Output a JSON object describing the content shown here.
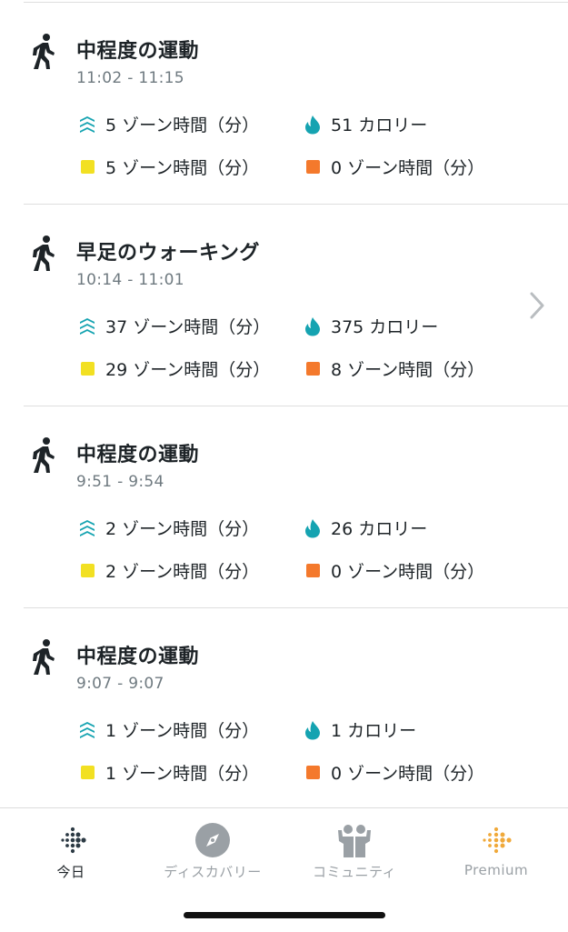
{
  "colors": {
    "accent_teal": "#15a3b1",
    "yellow": "#f2e022",
    "orange": "#f4792c",
    "premium": "#f0a93a"
  },
  "activities": [
    {
      "title": "中程度の運動",
      "time": "11:02 - 11:15",
      "active_zone": "5 ゾーン時間（分）",
      "calories": "51 カロリー",
      "fat_burn": "5 ゾーン時間（分）",
      "cardio": "0 ゾーン時間（分）",
      "has_chevron": false
    },
    {
      "title": "早足のウォーキング",
      "time": "10:14 - 11:01",
      "active_zone": "37 ゾーン時間（分）",
      "calories": "375 カロリー",
      "fat_burn": "29 ゾーン時間（分）",
      "cardio": "8 ゾーン時間（分）",
      "has_chevron": true
    },
    {
      "title": "中程度の運動",
      "time": "9:51 - 9:54",
      "active_zone": "2 ゾーン時間（分）",
      "calories": "26 カロリー",
      "fat_burn": "2 ゾーン時間（分）",
      "cardio": "0 ゾーン時間（分）",
      "has_chevron": false
    },
    {
      "title": "中程度の運動",
      "time": "9:07 - 9:07",
      "active_zone": "1 ゾーン時間（分）",
      "calories": "1 カロリー",
      "fat_burn": "1 ゾーン時間（分）",
      "cardio": "0 ゾーン時間（分）",
      "has_chevron": false
    }
  ],
  "tabbar": {
    "today": "今日",
    "discover": "ディスカバリー",
    "community": "コミュニティ",
    "premium": "Premium"
  },
  "icons": {
    "activity": "walking-icon",
    "zone": "active-zone-icon",
    "calories": "flame-icon",
    "fat_burn": "fat-burn-square-icon",
    "cardio": "cardio-square-icon"
  }
}
